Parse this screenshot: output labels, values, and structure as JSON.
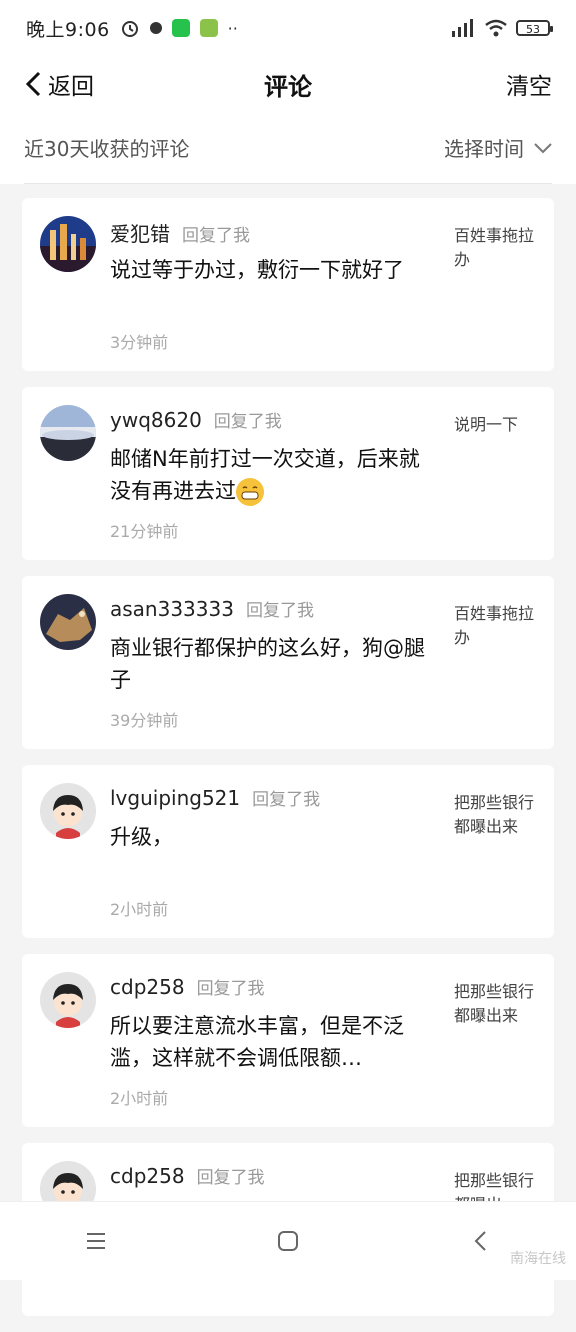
{
  "status_bar": {
    "time": "晚上9:06",
    "battery": "53"
  },
  "header": {
    "back_label": "返回",
    "title": "评论",
    "clear_label": "清空"
  },
  "filter": {
    "label": "近30天收获的评论",
    "select_label": "选择时间"
  },
  "comments": [
    {
      "name": "爱犯错",
      "replied": "回复了我",
      "text": "说过等于办过，敷衍一下就好了",
      "time": "3分钟前",
      "source": "百姓事拖拉办"
    },
    {
      "name": "ywq8620",
      "replied": "回复了我",
      "text": "邮储N年前打过一次交道，后来就没有再进去过",
      "time": "21分钟前",
      "source": "说明一下"
    },
    {
      "name": "asan333333",
      "replied": "回复了我",
      "text": "商业银行都保护的这么好，狗@腿子",
      "time": "39分钟前",
      "source": "百姓事拖拉办"
    },
    {
      "name": "lvguiping521",
      "replied": "回复了我",
      "text": "升级，",
      "time": "2小时前",
      "source": "把那些银行都曝出来"
    },
    {
      "name": "cdp258",
      "replied": "回复了我",
      "text": "所以要注意流水丰富，但是不泛滥，这样就不会调低限额…",
      "time": "2小时前",
      "source": "把那些银行都曝出来"
    },
    {
      "name": "cdp258",
      "replied": "回复了我",
      "text": "",
      "time": "",
      "source": "把那些银行都曝出"
    }
  ],
  "watermark": "南海在线"
}
